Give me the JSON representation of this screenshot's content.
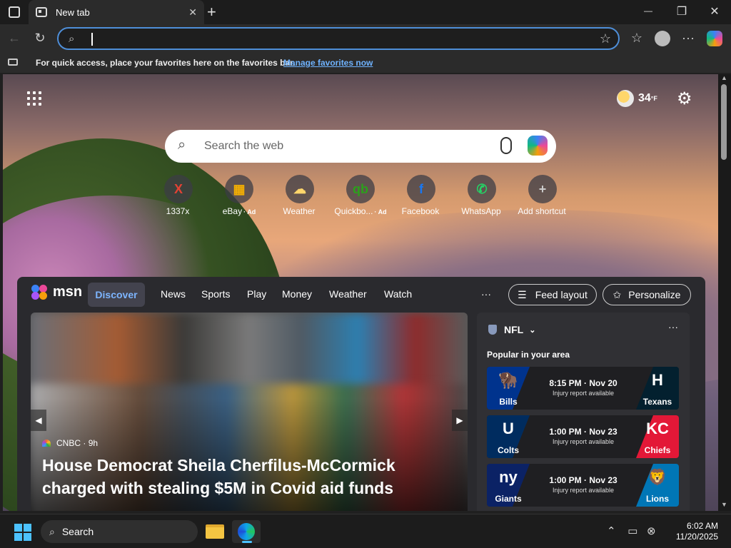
{
  "tab": {
    "title": "New tab",
    "close": "✕",
    "new": "+"
  },
  "window": {
    "minimize": "—",
    "maximize": "❐",
    "close": "✕"
  },
  "address": {
    "value": ""
  },
  "favbar": {
    "text": "For quick access, place your favorites here on the favorites bar.",
    "link": "Manage favorites now"
  },
  "weather": {
    "temp": "34",
    "unit": "°F"
  },
  "search": {
    "placeholder": "Search the web"
  },
  "shortcuts": [
    {
      "label": "1337x",
      "ad": "",
      "glyph": "X",
      "color": "#e34234"
    },
    {
      "label": "eBay",
      "ad": "· Ad",
      "glyph": "▦",
      "color": "#f5af02"
    },
    {
      "label": "Weather",
      "ad": "",
      "glyph": "☁",
      "color": "#ffd66b"
    },
    {
      "label": "Quickbo...",
      "ad": "· Ad",
      "glyph": "qb",
      "color": "#2ca01c"
    },
    {
      "label": "Facebook",
      "ad": "",
      "glyph": "f",
      "color": "#1877f2"
    },
    {
      "label": "WhatsApp",
      "ad": "",
      "glyph": "✆",
      "color": "#25d366"
    },
    {
      "label": "Add shortcut",
      "ad": "",
      "glyph": "+",
      "color": "#cccccc"
    }
  ],
  "msn": {
    "logo": "msn",
    "tabs": [
      "Discover",
      "News",
      "Sports",
      "Play",
      "Money",
      "Weather",
      "Watch"
    ],
    "more": "···",
    "feed_layout": "Feed layout",
    "personalize": "Personalize"
  },
  "hero": {
    "source": "CNBC",
    "age": "· 9h",
    "headline": "House Democrat Sheila Cherfilus-McCormick charged with stealing $5M in Covid aid funds"
  },
  "nfl": {
    "title": "NFL",
    "subtitle": "Popular in your area",
    "games": [
      {
        "away": "Bills",
        "home": "Texans",
        "time": "8:15 PM · Nov 20",
        "note": "Injury report available",
        "away_color": "#00338d",
        "home_color": "#03202f",
        "away_logo": "🦬",
        "home_logo": "H"
      },
      {
        "away": "Colts",
        "home": "Chiefs",
        "time": "1:00 PM · Nov 23",
        "note": "Injury report available",
        "away_color": "#002c5f",
        "home_color": "#e31837",
        "away_logo": "U",
        "home_logo": "KC"
      },
      {
        "away": "Giants",
        "home": "Lions",
        "time": "1:00 PM · Nov 23",
        "note": "Injury report available",
        "away_color": "#0b2265",
        "home_color": "#0076b6",
        "away_logo": "ny",
        "home_logo": "🦁"
      }
    ]
  },
  "taskbar": {
    "search": "Search",
    "time": "6:02 AM",
    "date": "11/20/2025"
  }
}
